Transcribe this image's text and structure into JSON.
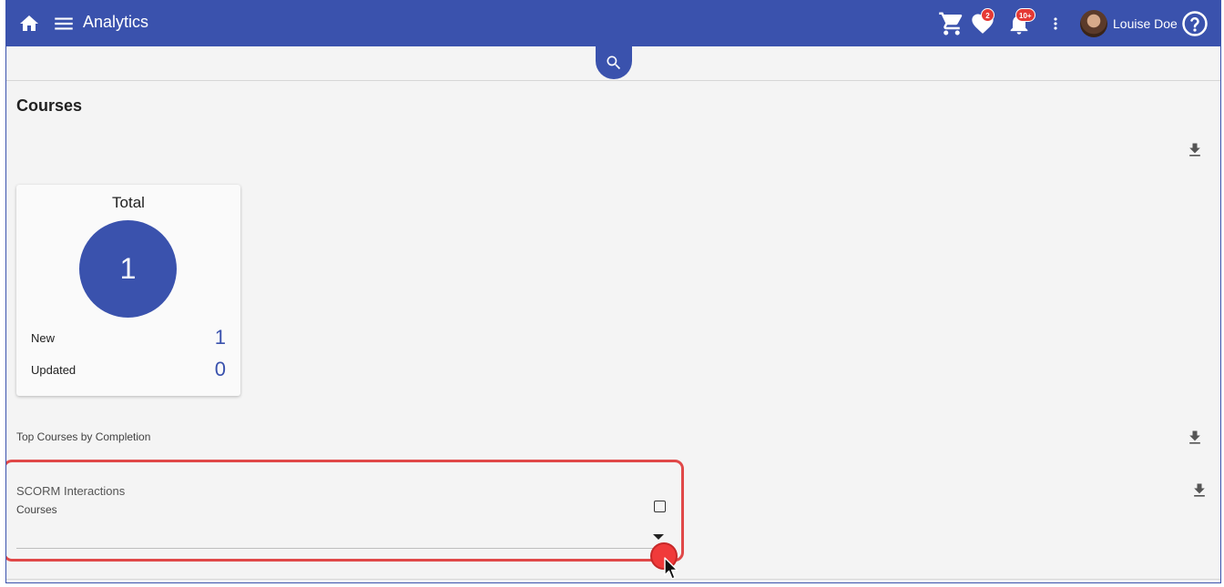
{
  "header": {
    "app_title": "Analytics",
    "favorites_badge": "2",
    "notifications_badge": "10+",
    "user_name": "Louise Doe"
  },
  "page": {
    "title": "Courses"
  },
  "total_card": {
    "title": "Total",
    "total": "1",
    "stats": [
      {
        "label": "New",
        "value": "1"
      },
      {
        "label": "Updated",
        "value": "0"
      }
    ]
  },
  "sections": {
    "top_courses_label": "Top Courses by Completion",
    "scorm_title": "SCORM Interactions",
    "scorm_courses_label": "Courses"
  },
  "colors": {
    "brand": "#3a52ad",
    "badge": "#e53935",
    "highlight": "#e04848"
  }
}
